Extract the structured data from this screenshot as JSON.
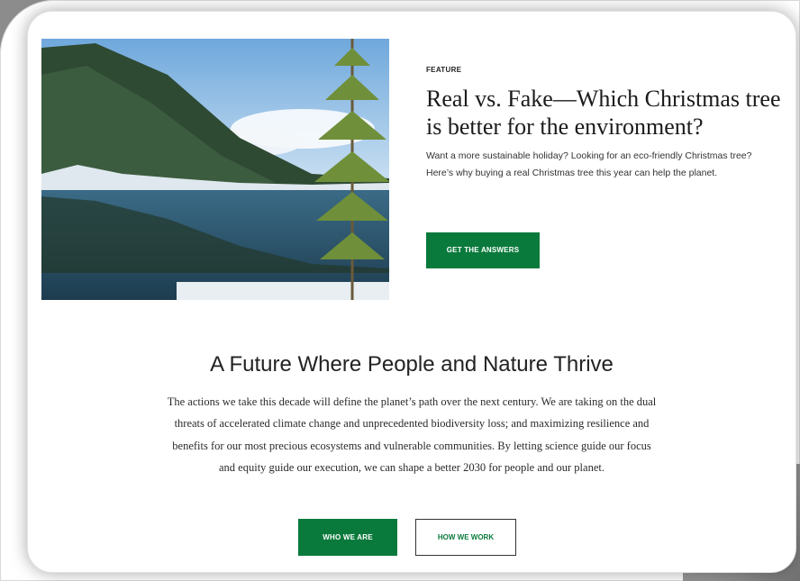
{
  "feature": {
    "kicker": "FEATURE",
    "headline": "Real vs. Fake—Which Christmas tree is better for the environment?",
    "dek": "Want a more sustainable holiday? Looking for an eco-friendly Christmas tree? Here’s why buying a real Christmas tree this year can help the planet.",
    "cta_label": "GET THE ANSWERS",
    "image_subject": "snowy-forest-lake-with-pine-tree"
  },
  "mission": {
    "title": "A Future Where People and Nature Thrive",
    "body": "The actions we take this decade will define the planet’s path over the next century. We are taking on the dual threats of accelerated climate change and unprecedented biodiversity loss; and maximizing resilience and benefits for our most precious ecosystems and vulnerable communities. By letting science guide our focus and equity guide our execution, we can shape a better 2030 for people and our planet.",
    "primary_label": "WHO WE ARE",
    "secondary_label": "HOW WE WORK"
  },
  "colors": {
    "brand_green": "#0a7a3c",
    "text_dark": "#1b1b1b"
  }
}
